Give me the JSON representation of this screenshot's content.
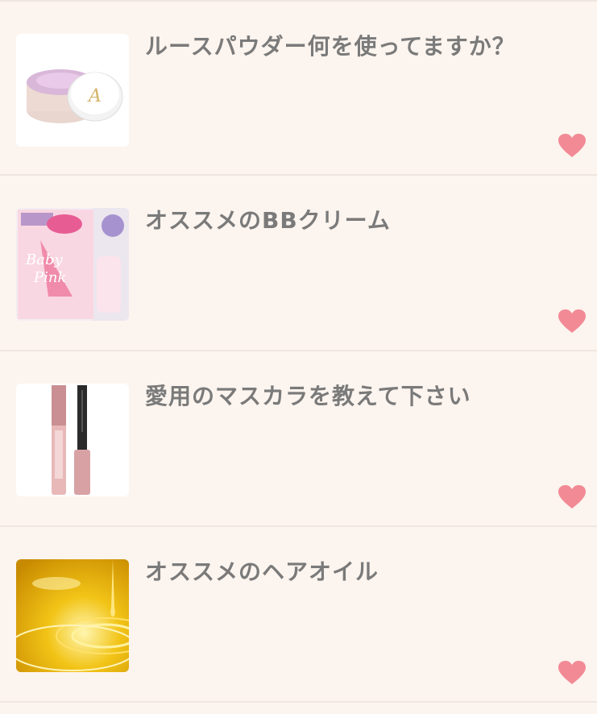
{
  "topics": [
    {
      "title": "ルースパウダー何を使ってますか？",
      "thumb": "loose-powder-jar-image",
      "favorite_icon": "heart-icon"
    },
    {
      "title": "オススメのBBクリーム",
      "thumb": "bb-cream-package-image",
      "favorite_icon": "heart-icon"
    },
    {
      "title": "愛用のマスカラを教えて下さい",
      "thumb": "mascara-tubes-image",
      "favorite_icon": "heart-icon"
    },
    {
      "title": "オススメのヘアオイル",
      "thumb": "golden-hair-oil-image",
      "favorite_icon": "heart-icon"
    }
  ],
  "colors": {
    "background": "#fcf4ee",
    "divider": "#efe6e0",
    "title_text": "#7a7a7a",
    "heart": "#f28a95"
  }
}
